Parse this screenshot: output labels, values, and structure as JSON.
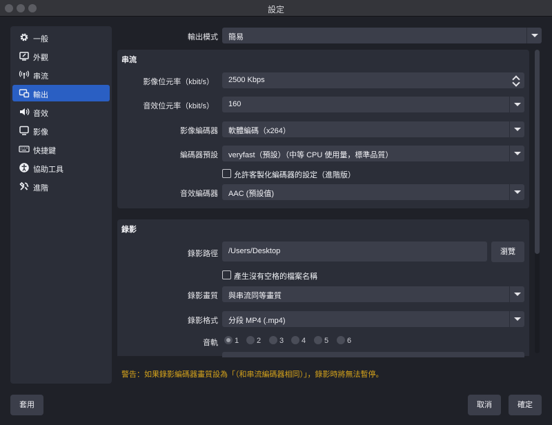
{
  "window": {
    "title": "設定"
  },
  "sidebar": {
    "items": [
      {
        "label": "一般",
        "icon": "gear-icon"
      },
      {
        "label": "外觀",
        "icon": "appearance-icon"
      },
      {
        "label": "串流",
        "icon": "broadcast-icon"
      },
      {
        "label": "輸出",
        "icon": "output-icon"
      },
      {
        "label": "音效",
        "icon": "speaker-icon"
      },
      {
        "label": "影像",
        "icon": "monitor-icon"
      },
      {
        "label": "快捷鍵",
        "icon": "keyboard-icon"
      },
      {
        "label": "協助工具",
        "icon": "accessibility-icon"
      },
      {
        "label": "進階",
        "icon": "wrench-icon"
      }
    ],
    "selected": "輸出"
  },
  "output_mode": {
    "label": "輸出模式",
    "value": "簡易"
  },
  "streaming": {
    "title": "串流",
    "video_bitrate": {
      "label": "影像位元率（kbit/s）",
      "value": "2500 Kbps"
    },
    "audio_bitrate": {
      "label": "音效位元率（kbit/s）",
      "value": "160"
    },
    "video_encoder": {
      "label": "影像編碼器",
      "value": "軟體編碼（x264）"
    },
    "encoder_preset": {
      "label": "編碼器預設",
      "value": "veryfast（預設）（中等 CPU 使用量，標準品質）"
    },
    "custom_encoder": {
      "label": "允許客製化編碼器的設定（進階版）",
      "checked": false
    },
    "audio_encoder": {
      "label": "音效編碼器",
      "value": "AAC (預設值)"
    }
  },
  "recording": {
    "title": "錄影",
    "path": {
      "label": "錄影路徑",
      "value": "/Users/Desktop",
      "browse": "瀏覽"
    },
    "no_space": {
      "label": "產生沒有空格的檔案名稱",
      "checked": false
    },
    "quality": {
      "label": "錄影畫質",
      "value": "與串流同等畫質"
    },
    "format": {
      "label": "錄影格式",
      "value": "分段 MP4 (.mp4)"
    },
    "tracks": {
      "label": "音軌",
      "options": [
        "1",
        "2",
        "3",
        "4",
        "5",
        "6"
      ],
      "selected": "1"
    }
  },
  "warning": "警告：如果錄影編碼器畫質設為「（和串流編碼器相同）」，錄影時將無法暫停。",
  "footer": {
    "apply": "套用",
    "cancel": "取消",
    "ok": "確定"
  },
  "colors": {
    "accent": "#2a5fc3",
    "warning": "#d4a21b",
    "panel": "#2b2e38",
    "field": "#3b3e4a",
    "background": "#1f2128"
  }
}
